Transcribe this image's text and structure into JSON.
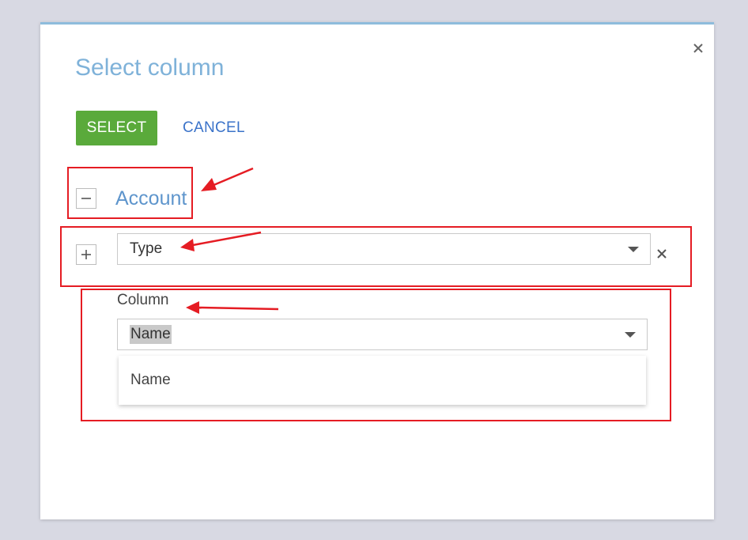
{
  "dialog": {
    "title": "Select column",
    "close_icon": "close-icon"
  },
  "toolbar": {
    "select_label": "SELECT",
    "cancel_label": "CANCEL",
    "select_color": "#5aaa3b",
    "cancel_color": "#3b73c9"
  },
  "tree": {
    "root": {
      "label": "Account",
      "toggle_icon": "minus-icon",
      "expanded": true
    },
    "child": {
      "toggle_icon": "plus-icon",
      "expanded": false,
      "select_value": "Type",
      "remove_icon": "close-icon"
    }
  },
  "column": {
    "label": "Column",
    "selected_value": "Name",
    "options": [
      "Name"
    ]
  },
  "annotations": {
    "box_color": "#e51c23",
    "arrow_color": "#e51c23"
  }
}
